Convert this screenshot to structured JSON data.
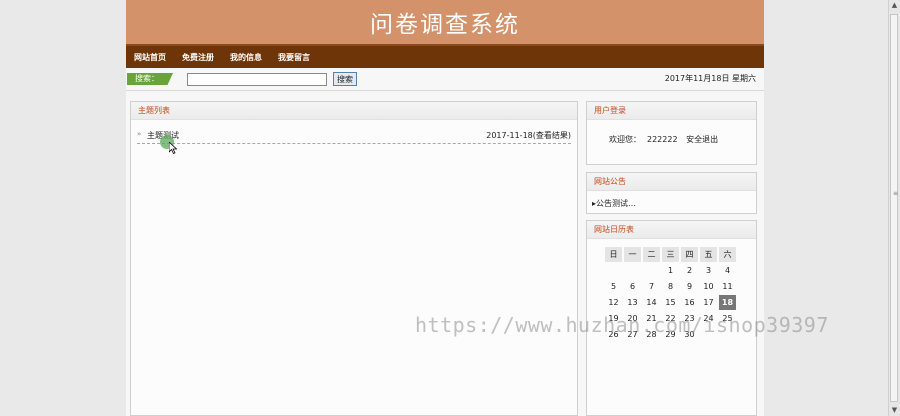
{
  "site": {
    "title": "问卷调查系统"
  },
  "nav": {
    "items": [
      "网站首页",
      "免费注册",
      "我的信息",
      "我要留言"
    ]
  },
  "search": {
    "label": "搜索：",
    "value": "",
    "button": "搜索"
  },
  "date": "2017年11月18日 星期六",
  "topic_list": {
    "title": "主题列表",
    "items": [
      {
        "bullet": "»",
        "title": "主题测试",
        "date": "2017-11-18",
        "action": "(查看结果)"
      }
    ]
  },
  "login": {
    "title": "用户登录",
    "welcome": "欢迎您：",
    "username": "222222",
    "logout": "安全退出"
  },
  "notice": {
    "title": "网站公告",
    "items": [
      "公告测试…"
    ]
  },
  "calendar": {
    "title": "网站日历表",
    "weekdays": [
      "日",
      "一",
      "二",
      "三",
      "四",
      "五",
      "六"
    ],
    "today": 18,
    "weeks": [
      [
        "",
        "",
        "",
        "1",
        "2",
        "3",
        "4"
      ],
      [
        "5",
        "6",
        "7",
        "8",
        "9",
        "10",
        "11"
      ],
      [
        "12",
        "13",
        "14",
        "15",
        "16",
        "17",
        "18"
      ],
      [
        "19",
        "20",
        "21",
        "22",
        "23",
        "24",
        "25"
      ],
      [
        "26",
        "27",
        "28",
        "29",
        "30",
        "",
        ""
      ]
    ]
  },
  "watermark": "https://www.huzhan.com/ishop39397"
}
